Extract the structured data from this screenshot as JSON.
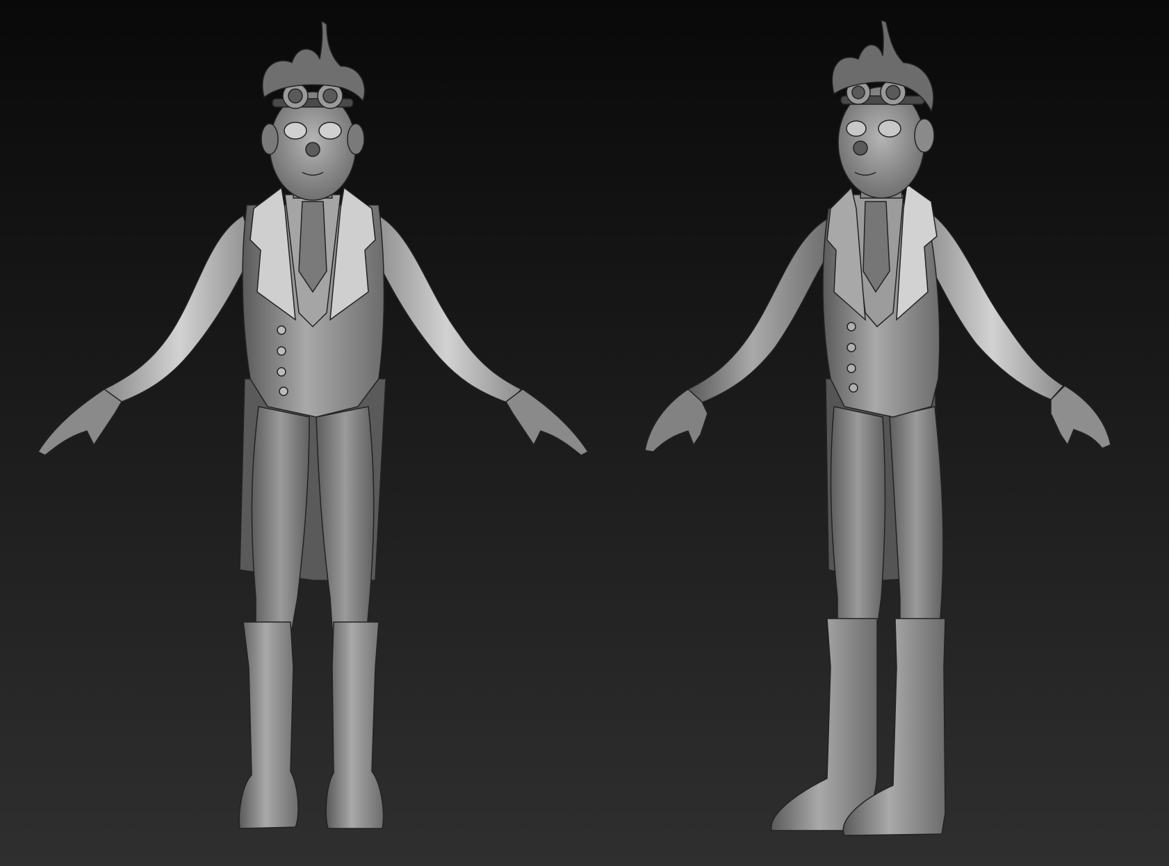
{
  "viewport": {
    "background_top": "#090909",
    "background_bottom": "#2f2f2f"
  },
  "models": [
    {
      "view": "front",
      "pose": "A-pose"
    },
    {
      "view": "three-quarter",
      "pose": "A-pose"
    }
  ],
  "material": {
    "base": "#8e8e8e",
    "light": "#c8c8c8",
    "dark": "#3e3e3e",
    "outline": "#202020"
  }
}
